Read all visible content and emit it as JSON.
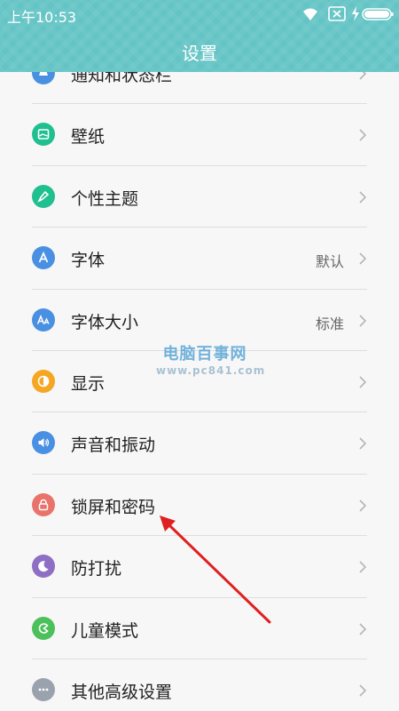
{
  "status_bar": {
    "time": "上午10:53",
    "icons": [
      "wifi-icon",
      "sim-icon",
      "bolt-icon",
      "battery-icon"
    ]
  },
  "header": {
    "title": "设置"
  },
  "settings": [
    {
      "label": "通知和状态栏",
      "value": "",
      "icon": "notification-icon",
      "color": "#4a90e2"
    },
    {
      "label": "壁纸",
      "value": "",
      "icon": "wallpaper-icon",
      "color": "#1fbf8f"
    },
    {
      "label": "个性主题",
      "value": "",
      "icon": "theme-brush-icon",
      "color": "#1fbf8f"
    },
    {
      "label": "字体",
      "value": "默认",
      "icon": "font-icon",
      "color": "#4a90e2"
    },
    {
      "label": "字体大小",
      "value": "标准",
      "icon": "font-size-icon",
      "color": "#4a90e2"
    },
    {
      "label": "显示",
      "value": "",
      "icon": "display-icon",
      "color": "#f5a623"
    },
    {
      "label": "声音和振动",
      "value": "",
      "icon": "speaker-icon",
      "color": "#4a90e2"
    },
    {
      "label": "锁屏和密码",
      "value": "",
      "icon": "lock-icon",
      "color": "#e9736a"
    },
    {
      "label": "防打扰",
      "value": "",
      "icon": "moon-icon",
      "color": "#8e6fc4"
    },
    {
      "label": "儿童模式",
      "value": "",
      "icon": "kids-mode-icon",
      "color": "#4cc05a"
    },
    {
      "label": "其他高级设置",
      "value": "",
      "icon": "more-icon",
      "color": "#9aa3ad"
    }
  ],
  "watermark": {
    "title": "电脑百事网",
    "url": "www.pc841.com"
  },
  "annotation": {
    "color": "#e02020"
  }
}
